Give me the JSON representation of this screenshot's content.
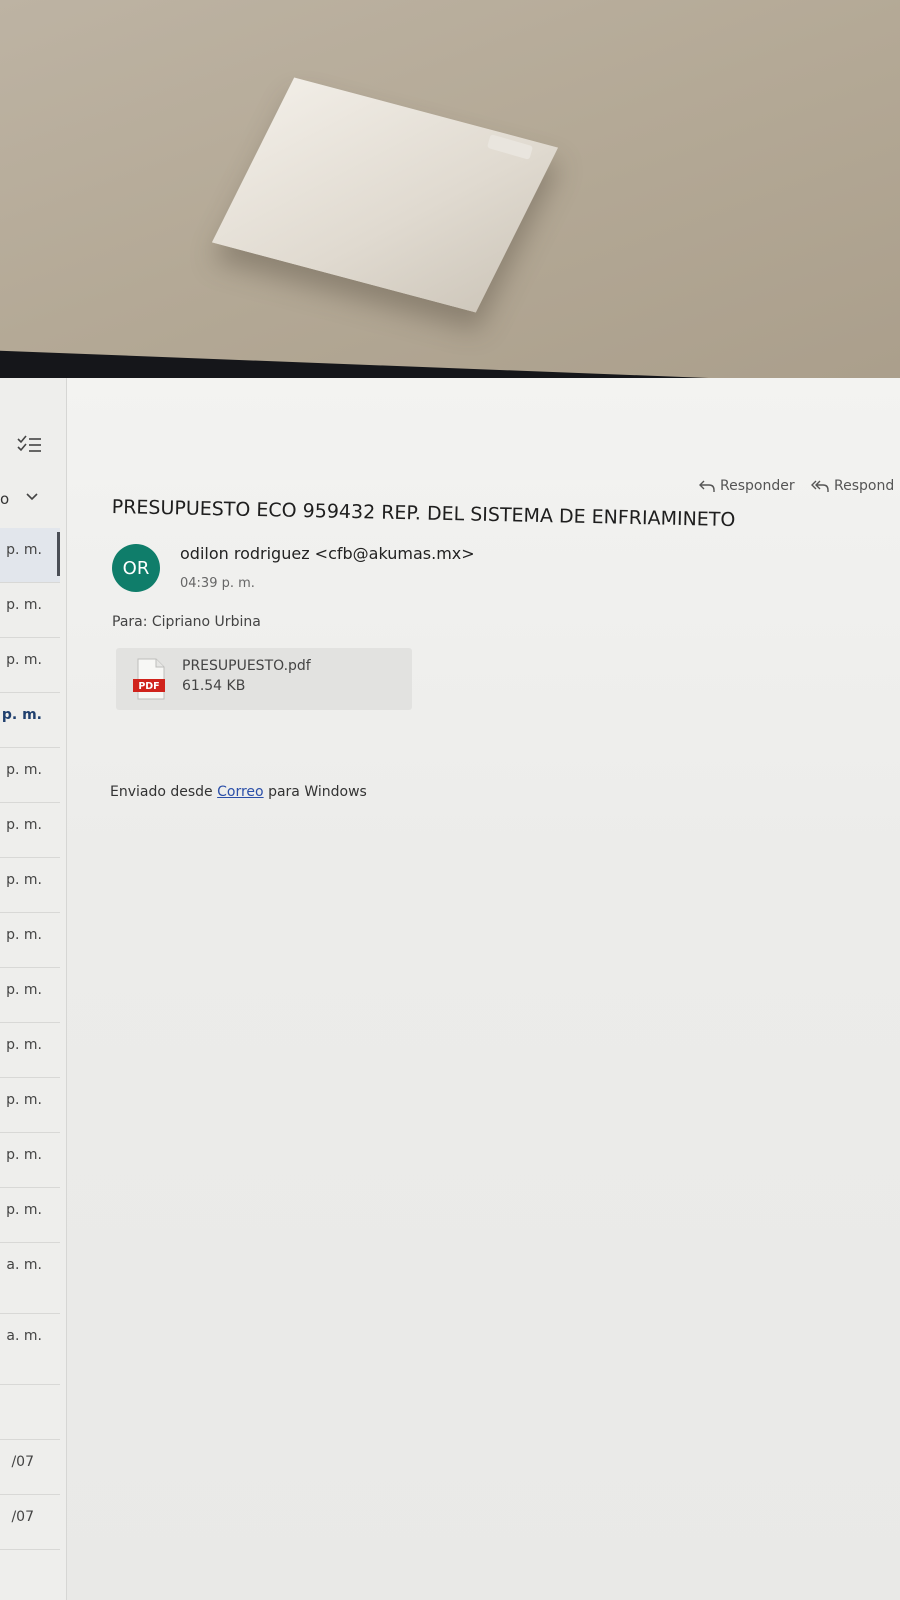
{
  "message_list": {
    "filter_label": "o",
    "items": [
      {
        "time": "p. m.",
        "state": "selected"
      },
      {
        "time": "p. m.",
        "state": "normal"
      },
      {
        "time": "p. m.",
        "state": "normal"
      },
      {
        "time": "p. m.",
        "state": "unread"
      },
      {
        "time": "p. m.",
        "state": "normal"
      },
      {
        "time": "p. m.",
        "state": "normal"
      },
      {
        "time": "p. m.",
        "state": "normal"
      },
      {
        "time": "p. m.",
        "state": "normal"
      },
      {
        "time": "p. m.",
        "state": "normal"
      },
      {
        "time": "p. m.",
        "state": "normal"
      },
      {
        "time": "p. m.",
        "state": "normal"
      },
      {
        "time": "p. m.",
        "state": "normal"
      },
      {
        "time": "p. m.",
        "state": "normal"
      },
      {
        "time": "a. m.",
        "state": "normal"
      }
    ],
    "later_items": [
      "a. m.",
      "",
      "/07",
      "/07"
    ]
  },
  "toolbar": {
    "reply_label": "Responder",
    "reply_all_label": "Respond"
  },
  "email": {
    "subject": "PRESUPUESTO ECO 959432 REP. DEL SISTEMA DE ENFRIAMINETO",
    "avatar_initials": "OR",
    "avatar_color": "#0f7d6a",
    "sender": "odilon rodriguez <cfb@akumas.mx>",
    "time": "04:39 p. m.",
    "to": "Para: Cipriano Urbina",
    "attachment": {
      "icon": "pdf-file-icon",
      "badge": "PDF",
      "name": "PRESUPUESTO.pdf",
      "size": "61.54 KB"
    },
    "signature": {
      "prefix": "Enviado desde",
      "link": "Correo",
      "suffix": "para Windows"
    }
  }
}
